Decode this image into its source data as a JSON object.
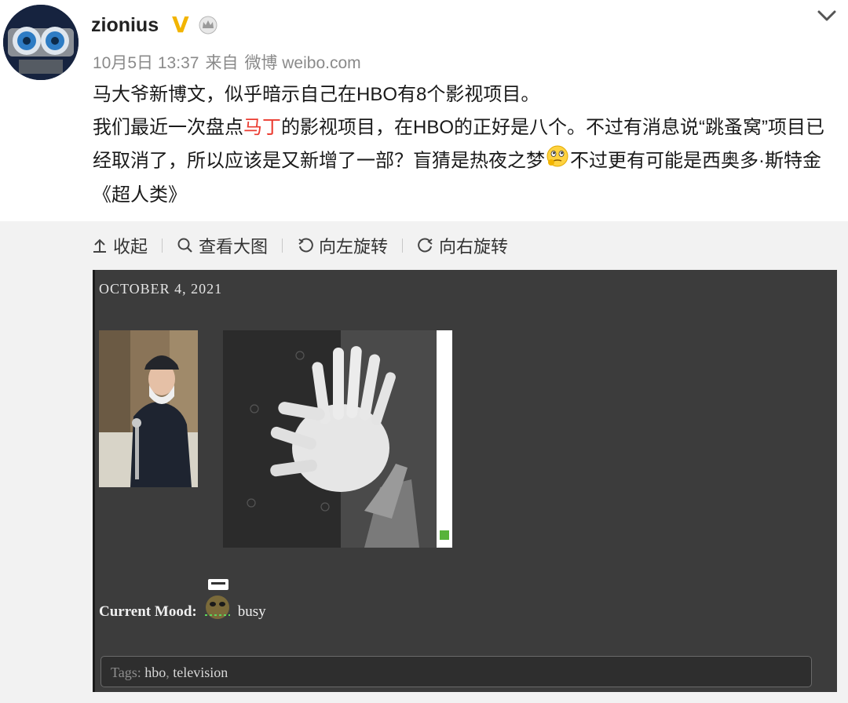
{
  "post": {
    "author": "zionius",
    "verified_badge": "V",
    "badge_icon": "crown-icon",
    "timestamp": "10月5日 13:37",
    "source_prefix": "来自",
    "source": "微博 weibo.com",
    "text_line1": "马大爷新博文，似乎暗示自己在HBO有8个影视项目。",
    "text_line2_before": "我们最近一次盘点",
    "text_mention": "马丁",
    "text_line2_after": "的影视项目，在HBO的正好是八个。不过有消息说“跳蚤窝”项目已经取消了，所以应该是又新增了一部？盲猜是热夜之梦",
    "text_line2_end": "不过更有可能是西奥多·斯特金《超人类》",
    "emoji_icon": "thinking-face-emoji"
  },
  "toolbar": {
    "collapse": "收起",
    "view_large": "查看大图",
    "rotate_left": "向左旋转",
    "rotate_right": "向右旋转"
  },
  "embedded_image": {
    "date": "OCTOBER 4, 2021",
    "mood_label": "Current Mood:",
    "mood_value": "busy",
    "tags_label": "Tags:",
    "tag_1": "hbo",
    "tag_separator": ",",
    "tag_2": "television"
  },
  "colors": {
    "mention": "#eb3b30",
    "vip": "#f2b400",
    "meta": "#8a8a8a",
    "image_bg": "#3c3c3c"
  }
}
